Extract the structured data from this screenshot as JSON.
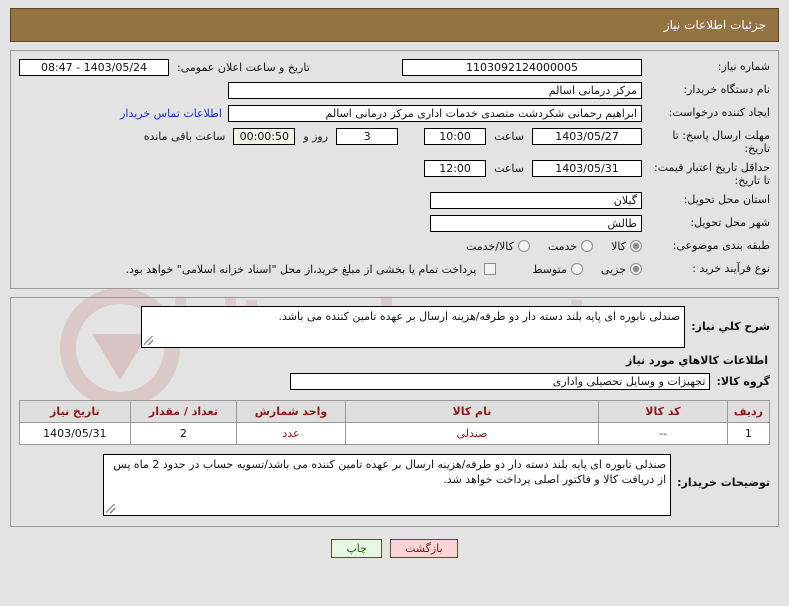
{
  "header": {
    "title": "جزئیات اطلاعات نیاز"
  },
  "form": {
    "need_number_label": "شماره نیاز:",
    "need_number_value": "1103092124000005",
    "announce_label": "تاریخ و ساعت اعلان عمومی:",
    "announce_value": "1403/05/24 - 08:47",
    "buyer_org_label": "نام دستگاه خریدار:",
    "buyer_org_value": "مرکز درمانی اسالم",
    "creator_label": "ایجاد کننده درخواست:",
    "creator_value": "ابراهیم رحمانی شکردشت متصدی خدمات اداری مرکز درمانی اسالم",
    "contact_link": "اطلاعات تماس خریدار",
    "deadline_label": "مهلت ارسال پاسخ: تا تاریخ:",
    "deadline_date": "1403/05/27",
    "hour_label": "ساعت",
    "deadline_time": "10:00",
    "days_remaining": "3",
    "days_and_label": "روز و",
    "countdown": "00:00:50",
    "remaining_label": "ساعت باقی مانده",
    "validity_label": "حداقل تاریخ اعتبار قیمت: تا تاریخ:",
    "validity_date": "1403/05/31",
    "validity_time": "12:00",
    "province_label": "استان محل تحویل:",
    "province_value": "گیلان",
    "city_label": "شهر محل تحویل:",
    "city_value": "طالش",
    "category_label": "طبقه بندی موضوعی:",
    "category_options": [
      {
        "label": "کالا",
        "checked": true
      },
      {
        "label": "خدمت",
        "checked": false
      },
      {
        "label": "کالا/خدمت",
        "checked": false
      }
    ],
    "process_label": "نوع فرآیند خرید :",
    "process_options": [
      {
        "label": "جزیی",
        "checked": true
      },
      {
        "label": "متوسط",
        "checked": false
      }
    ],
    "treasury_checkbox_label": "پرداخت تمام یا بخشی از مبلغ خرید،از محل \"اسناد خزانه اسلامی\" خواهد بود."
  },
  "need_description": {
    "label": "شرح کلي نياز:",
    "value": "صندلی تابوره ای پایه بلند دسته دار دو طرفه/هزینه ارسال بر عهده تامین کننده می باشد."
  },
  "goods_section": {
    "title": "اطلاعات کالاهاي مورد نياز",
    "group_label": "گروه کالا:",
    "group_value": "تجهیزات و وسایل تحصیلی واداری",
    "table": {
      "columns": [
        "ردیف",
        "کد کالا",
        "نام کالا",
        "واحد شمارش",
        "تعداد / مقدار",
        "تاریخ نیاز"
      ],
      "rows": [
        [
          "1",
          "--",
          "صندلی",
          "عدد",
          "2",
          "1403/05/31"
        ]
      ]
    }
  },
  "buyer_notes": {
    "label": "توضیحات خریدار:",
    "value": "صندلی تابوره ای پایه بلند دسته دار دو طرفه/هزینه ارسال بر عهده تامین کننده می باشد/تسویه حساب در حدود 2 ماه پس از دریافت کالا و فاکتور اصلی پرداخت خواهد شد."
  },
  "footer": {
    "back_label": "بازگشت",
    "print_label": "چاپ"
  },
  "watermark": {
    "text": "iritender.net"
  },
  "colors": {
    "header_bg": "#937341",
    "link": "#1a2ad8",
    "table_text": "#8b1a1a",
    "back_btn": "#fbd5d5",
    "print_btn": "#e6f7e3"
  }
}
